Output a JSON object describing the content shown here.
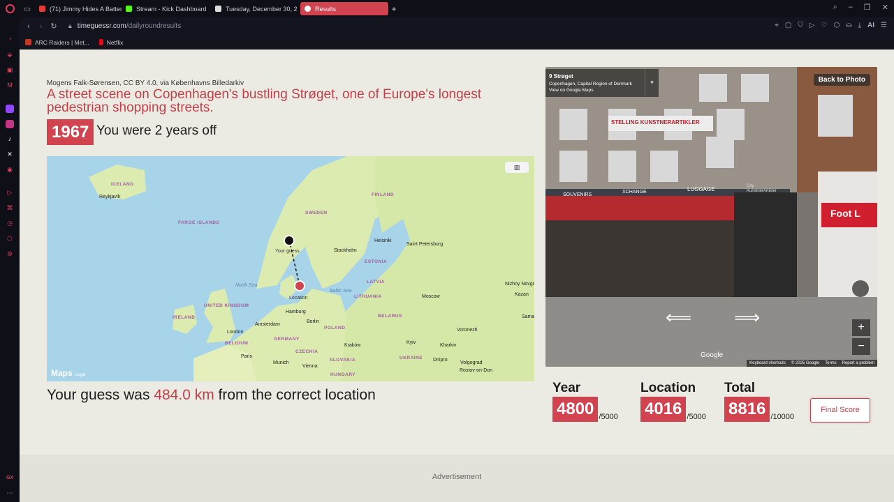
{
  "browser": {
    "tabs": [
      {
        "label": "(71) Jimmy Hides A Battery",
        "color": "#e53935"
      },
      {
        "label": "Stream - Kick Dashboard",
        "color": "#53fc18"
      },
      {
        "label": "Tuesday, December 30, 2",
        "color": "#dddddd"
      },
      {
        "label": "Results",
        "color": "#ffffff"
      }
    ],
    "url_host": "timeguessr.com",
    "url_path": "/dailyroundresults",
    "ai_label": "AI",
    "bookmarks": [
      {
        "label": "ARC Raiders | Met...",
        "color": "#c0392b"
      },
      {
        "label": "Netflix",
        "color": "#e50914"
      }
    ],
    "sidebar_badge": "GX"
  },
  "result": {
    "credit": "Mogens Falk-Sørensen, CC BY 4.0, via Københavns Billedarkiv",
    "headline": "A street scene on Copenhagen's bustling Strøget, one of Europe's longest pedestrian shopping streets.",
    "year": "1967",
    "year_message": "You were 2 years off",
    "distance_prefix": "Your guess was ",
    "distance_value": "484.0 km",
    "distance_suffix": " from the correct location"
  },
  "map": {
    "brand": "Maps",
    "legal": "Legal",
    "guess_label": "Your guess",
    "location_label": "Location",
    "labels": [
      {
        "text": "ICELAND",
        "kind": "country"
      },
      {
        "text": "Reykjavík",
        "kind": "city"
      },
      {
        "text": "FAROE ISLANDS",
        "kind": "country"
      },
      {
        "text": "SWEDEN",
        "kind": "country"
      },
      {
        "text": "FINLAND",
        "kind": "country"
      },
      {
        "text": "Helsinki",
        "kind": "city"
      },
      {
        "text": "Saint Petersburg",
        "kind": "city"
      },
      {
        "text": "Stockholm",
        "kind": "city"
      },
      {
        "text": "ESTONIA",
        "kind": "country"
      },
      {
        "text": "LATVIA",
        "kind": "country"
      },
      {
        "text": "LITHUANIA",
        "kind": "country"
      },
      {
        "text": "North Sea",
        "kind": "sea"
      },
      {
        "text": "Baltic Sea",
        "kind": "sea"
      },
      {
        "text": "UNITED KINGDOM",
        "kind": "country"
      },
      {
        "text": "IRELAND",
        "kind": "country"
      },
      {
        "text": "Hamburg",
        "kind": "city"
      },
      {
        "text": "Berlin",
        "kind": "city"
      },
      {
        "text": "Amsterdam",
        "kind": "city"
      },
      {
        "text": "London",
        "kind": "city"
      },
      {
        "text": "Moscow",
        "kind": "city"
      },
      {
        "text": "Nizhny Novgorod",
        "kind": "city"
      },
      {
        "text": "Kazan",
        "kind": "city"
      },
      {
        "text": "BELARUS",
        "kind": "country"
      },
      {
        "text": "POLAND",
        "kind": "country"
      },
      {
        "text": "GERMANY",
        "kind": "country"
      },
      {
        "text": "BELGIUM",
        "kind": "country"
      },
      {
        "text": "Paris",
        "kind": "city"
      },
      {
        "text": "Munich",
        "kind": "city"
      },
      {
        "text": "Vienna",
        "kind": "city"
      },
      {
        "text": "CZECHIA",
        "kind": "country"
      },
      {
        "text": "SLOVAKIA",
        "kind": "country"
      },
      {
        "text": "HUNGARY",
        "kind": "country"
      },
      {
        "text": "Kraków",
        "kind": "city"
      },
      {
        "text": "Kyiv",
        "kind": "city"
      },
      {
        "text": "Kharkiv",
        "kind": "city"
      },
      {
        "text": "UKRAINE",
        "kind": "country"
      },
      {
        "text": "Dnipro",
        "kind": "city"
      },
      {
        "text": "Voronezh",
        "kind": "city"
      },
      {
        "text": "Volgograd",
        "kind": "city"
      },
      {
        "text": "Rostov-on-Don",
        "kind": "city"
      },
      {
        "text": "Sama",
        "kind": "city"
      }
    ]
  },
  "photo": {
    "title": "9 Strøget",
    "subtitle": "Copenhagen, Capital Region of Denmark",
    "link": "View on Google Maps",
    "back_label": "Back to Photo",
    "zoom_in": "+",
    "zoom_out": "−",
    "google": "Google",
    "attribution": [
      "Keyboard shortcuts",
      "© 2025 Google",
      "Terms",
      "Report a problem"
    ],
    "signs": {
      "stelling": "STELLING KUNSTNERARTIKLER",
      "souvenirs": "SOUVENIRS",
      "xchange": "XCHANGE",
      "luggage": "LUGGAGE",
      "city": "City KunstnerArtikler",
      "footl": "Foot L"
    }
  },
  "scores": {
    "year": {
      "label": "Year",
      "value": "4800",
      "max": "/5000"
    },
    "location": {
      "label": "Location",
      "value": "4016",
      "max": "/5000"
    },
    "total": {
      "label": "Total",
      "value": "8816",
      "max": "/10000"
    }
  },
  "final_button": "Final Score",
  "advertisement": "Advertisement",
  "colors": {
    "accent": "#d0434f",
    "accent_text": "#c2404a",
    "page_bg": "#ecebe3"
  }
}
